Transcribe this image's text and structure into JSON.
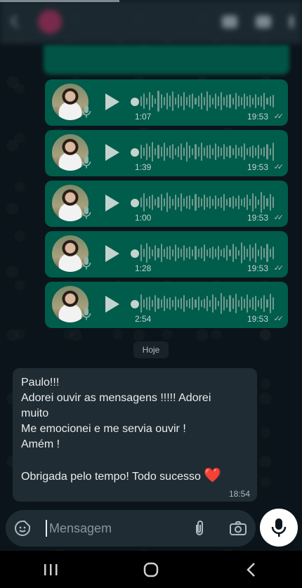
{
  "colors": {
    "outgoing_bubble": "#005c4b",
    "incoming_bubble": "#202c33",
    "background": "#0b141a",
    "heart": "#e53945"
  },
  "voice_messages": [
    {
      "duration": "1:07",
      "time": "19:53",
      "status": "double-check-icon"
    },
    {
      "duration": "1:39",
      "time": "19:53",
      "status": "double-check-icon"
    },
    {
      "duration": "1:00",
      "time": "19:53",
      "status": "double-check-icon"
    },
    {
      "duration": "1:28",
      "time": "19:53",
      "status": "double-check-icon"
    },
    {
      "duration": "2:54",
      "time": "19:53",
      "status": "double-check-icon"
    }
  ],
  "date_separator": "Hoje",
  "incoming_message": {
    "lines": [
      "Paulo!!!",
      "Adorei ouvir as mensagens !!!!! Adorei",
      "muito",
      "Me emocionei e me servia ouvir !",
      "Amém !",
      "",
      "Obrigada pelo tempo! Todo sucesso"
    ],
    "emoji": "❤️",
    "time": "18:54"
  },
  "composer": {
    "placeholder": "Mensagem",
    "icons": [
      "sticker-icon",
      "paperclip-icon",
      "camera-icon",
      "mic-icon"
    ]
  },
  "system_nav": {
    "icons": [
      "recents-icon",
      "home-icon",
      "back-icon"
    ]
  }
}
